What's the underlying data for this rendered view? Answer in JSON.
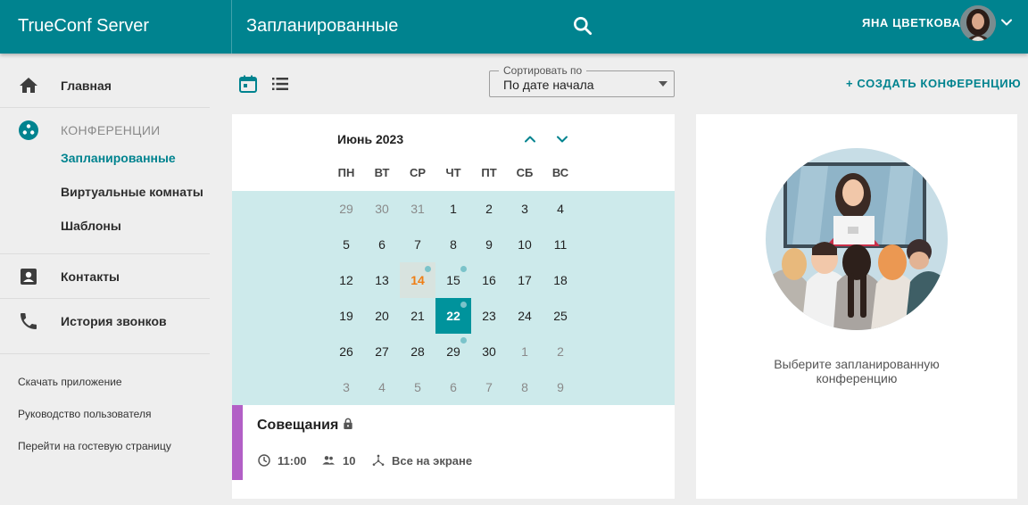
{
  "app": {
    "brand": "TrueConf Server"
  },
  "header": {
    "page_title": "Запланированные",
    "user_name": "ЯНА ЦВЕТКОВА",
    "accent_color": "#00838f"
  },
  "sidebar": {
    "home": "Главная",
    "conferences": "КОНФЕРЕНЦИИ",
    "sub_items": [
      "Запланированные",
      "Виртуальные комнаты",
      "Шаблоны"
    ],
    "contacts": "Контакты",
    "call_history": "История звонков",
    "footer_links": [
      "Скачать приложение",
      "Руководство пользователя",
      "Перейти на гостевую страницу"
    ]
  },
  "toolbar": {
    "sort_label": "Сортировать по",
    "sort_value": "По дате начала",
    "create_button": "+ СОЗДАТЬ КОНФЕРЕНЦИЮ"
  },
  "calendar": {
    "month_title": "Июнь 2023",
    "weekdays": [
      "ПН",
      "ВТ",
      "СР",
      "ЧТ",
      "ПТ",
      "СБ",
      "ВС"
    ],
    "weeks": [
      [
        "29",
        "30",
        "31",
        "1",
        "2",
        "3",
        "4"
      ],
      [
        "5",
        "6",
        "7",
        "8",
        "9",
        "10",
        "11"
      ],
      [
        "12",
        "13",
        "14",
        "15",
        "16",
        "17",
        "18"
      ],
      [
        "19",
        "20",
        "21",
        "22",
        "23",
        "24",
        "25"
      ],
      [
        "26",
        "27",
        "28",
        "29",
        "30",
        "1",
        "2"
      ],
      [
        "3",
        "4",
        "5",
        "6",
        "7",
        "8",
        "9"
      ]
    ],
    "today": "14",
    "selected": "22",
    "days_with_events": [
      "14",
      "15",
      "22",
      "29"
    ]
  },
  "event": {
    "title": "Совещания",
    "time": "11:00",
    "participants": "10",
    "layout": "Все на экране",
    "color": "#b25fc6"
  },
  "info_panel": {
    "message": "Выберите запланированную конференцию"
  }
}
